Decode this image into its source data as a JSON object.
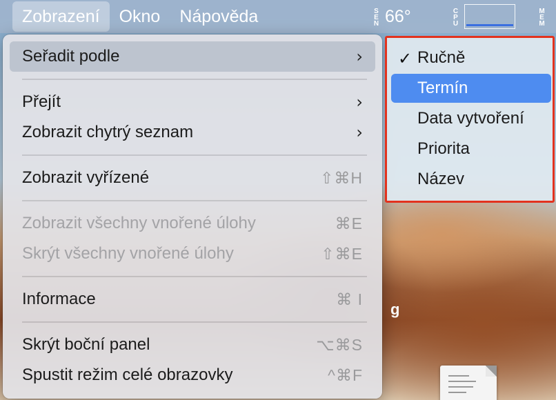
{
  "menubar": {
    "items": [
      "Zobrazení",
      "Okno",
      "Nápověda"
    ],
    "temp_label": "SEN",
    "temp_value": "66°",
    "cpu_label": "CPU",
    "mem_label": "MEM"
  },
  "menu": {
    "sort_by": "Seřadit podle",
    "go_to": "Přejít",
    "smart_list": "Zobrazit chytrý seznam",
    "show_completed": "Zobrazit vyřízené",
    "show_completed_shortcut": "⇧⌘H",
    "show_all_subtasks": "Zobrazit všechny vnořené úlohy",
    "show_all_subtasks_shortcut": "⌘E",
    "hide_all_subtasks": "Skrýt všechny vnořené úlohy",
    "hide_all_subtasks_shortcut": "⇧⌘E",
    "info": "Informace",
    "info_shortcut": "⌘ I",
    "hide_sidebar": "Skrýt boční panel",
    "hide_sidebar_shortcut": "⌥⌘S",
    "fullscreen": "Spustit režim celé obrazovky",
    "fullscreen_shortcut": "^⌘F",
    "chevron": "›"
  },
  "submenu": {
    "checkmark": "✓",
    "items": [
      "Ručně",
      "Termín",
      "Data vytvoření",
      "Priorita",
      "Název"
    ],
    "checked_item": "Ručně",
    "highlighted_item": "Termín"
  },
  "desktop": {
    "partial_text": "g"
  },
  "colors": {
    "highlight": "#4e8cf0",
    "annotation_border": "#e3321e"
  }
}
